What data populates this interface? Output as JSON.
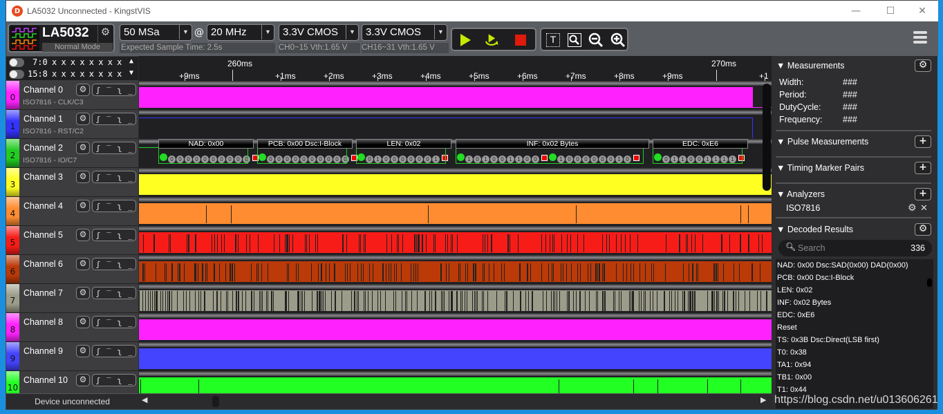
{
  "window": {
    "title": "LA5032 Unconnected - KingstVIS",
    "minimize": "—",
    "maximize": "☐",
    "close": "✕"
  },
  "toolbar": {
    "device_name": "LA5032",
    "device_mode": "Normal Mode",
    "sample_depth": "50 MSa",
    "at": "@",
    "sample_rate": "20 MHz",
    "expected_time": "Expected Sample Time: 2.5s",
    "threshold1": "3.3V CMOS",
    "threshold1_sub": "CH0~15 Vth:1.65 V",
    "threshold2": "3.3V CMOS",
    "threshold2_sub": "CH16~31 Vth:1.65 V",
    "run_icon": "play-icon",
    "loop_icon": "loop-run-icon",
    "stop_icon": "stop-icon",
    "text_tool_icon": "text-marker-icon",
    "zoom_fit_icon": "zoom-fit-icon",
    "zoom_out_icon": "zoom-out-icon",
    "zoom_in_icon": "zoom-in-icon",
    "menu_icon": "hamburger-menu-icon"
  },
  "bit_display": [
    {
      "label": "7:0",
      "bits": "x x x x x x x x",
      "arrow": "▲"
    },
    {
      "label": "15:8",
      "bits": "x x x x x x x x",
      "arrow": "▼"
    }
  ],
  "channels": [
    {
      "num": "0",
      "name": "Channel 0",
      "sub": "ISO7816 - CLK/C3",
      "color": "#ff22ff"
    },
    {
      "num": "1",
      "name": "Channel 1",
      "sub": "ISO7816 - RST/C2",
      "color": "#3333ff"
    },
    {
      "num": "2",
      "name": "Channel 2",
      "sub": "ISO7816 - IO/C7",
      "color": "#22cc22"
    },
    {
      "num": "3",
      "name": "Channel 3",
      "sub": "",
      "color": "#ffff22"
    },
    {
      "num": "4",
      "name": "Channel 4",
      "sub": "",
      "color": "#ff8c30"
    },
    {
      "num": "5",
      "name": "Channel 5",
      "sub": "",
      "color": "#f81c18"
    },
    {
      "num": "6",
      "name": "Channel 6",
      "sub": "",
      "color": "#bb3a08"
    },
    {
      "num": "7",
      "name": "Channel 7",
      "sub": "",
      "color": "#9c9c8a"
    },
    {
      "num": "8",
      "name": "Channel 8",
      "sub": "",
      "color": "#ff22ff"
    },
    {
      "num": "9",
      "name": "Channel 9",
      "sub": "",
      "color": "#4444ff"
    },
    {
      "num": "10",
      "name": "Channel 10",
      "sub": "",
      "color": "#22ff22"
    }
  ],
  "trigger_glyphs": [
    "⌠",
    "‾",
    "ʅ",
    "_"
  ],
  "device_status": "Device unconnected",
  "ruler": {
    "major": [
      "260ms",
      "270ms"
    ],
    "minor": [
      "+9ms",
      "+1ms",
      "+2ms",
      "+3ms",
      "+4ms",
      "+5ms",
      "+6ms",
      "+7ms",
      "+8ms",
      "+9ms",
      "+1"
    ]
  },
  "decode_frames": [
    {
      "label": "NAD: 0x00",
      "bits": [
        "0",
        "0",
        "0",
        "0",
        "0",
        "0",
        "0",
        "0",
        "0",
        "0"
      ]
    },
    {
      "label": "PCB: 0x00 Dsc:I-Block",
      "bits": [
        "0",
        "0",
        "0",
        "0",
        "0",
        "0",
        "0",
        "0",
        "0",
        "0"
      ]
    },
    {
      "label": "LEN: 0x02",
      "bits": [
        "0",
        "1",
        "0",
        "0",
        "0",
        "0",
        "0",
        "0",
        "1"
      ]
    },
    {
      "label": "INF: 0x02 Bytes",
      "bits": [
        "1",
        "0",
        "1",
        "0",
        "0",
        "1",
        "1",
        "0",
        "0"
      ],
      "bits2": [
        "1",
        "0",
        "0",
        "0",
        "0",
        "0",
        "0",
        "1",
        "0"
      ]
    },
    {
      "label": "EDC: 0xE6",
      "bits": [
        "0",
        "1",
        "1",
        "0",
        "0",
        "1",
        "1",
        "1",
        "1"
      ]
    }
  ],
  "right_panel": {
    "measurements": {
      "title": "Measurements",
      "rows": [
        {
          "label": "Width:",
          "value": "###"
        },
        {
          "label": "Period:",
          "value": "###"
        },
        {
          "label": "DutyCycle:",
          "value": "###"
        },
        {
          "label": "Frequency:",
          "value": "###"
        }
      ]
    },
    "pulse_title": "Pulse Measurements",
    "timing_title": "Timing Marker Pairs",
    "analyzers_title": "Analyzers",
    "analyzer_item": "ISO7816",
    "decoded_title": "Decoded Results",
    "search_placeholder": "Search",
    "result_count": "336",
    "results": [
      "NAD: 0x00 Dsc:SAD(0x00) DAD(0x00)",
      "PCB: 0x00 Dsc:I-Block",
      "LEN: 0x02",
      "INF: 0x02 Bytes",
      "EDC: 0xE6",
      "Reset",
      "TS: 0x3B Dsc:Direct(LSB first)",
      "T0: 0x38",
      "TA1: 0x94",
      "TB1: 0x00",
      "T1: 0x44"
    ]
  },
  "watermark": "https://blog.csdn.net/u013606261"
}
